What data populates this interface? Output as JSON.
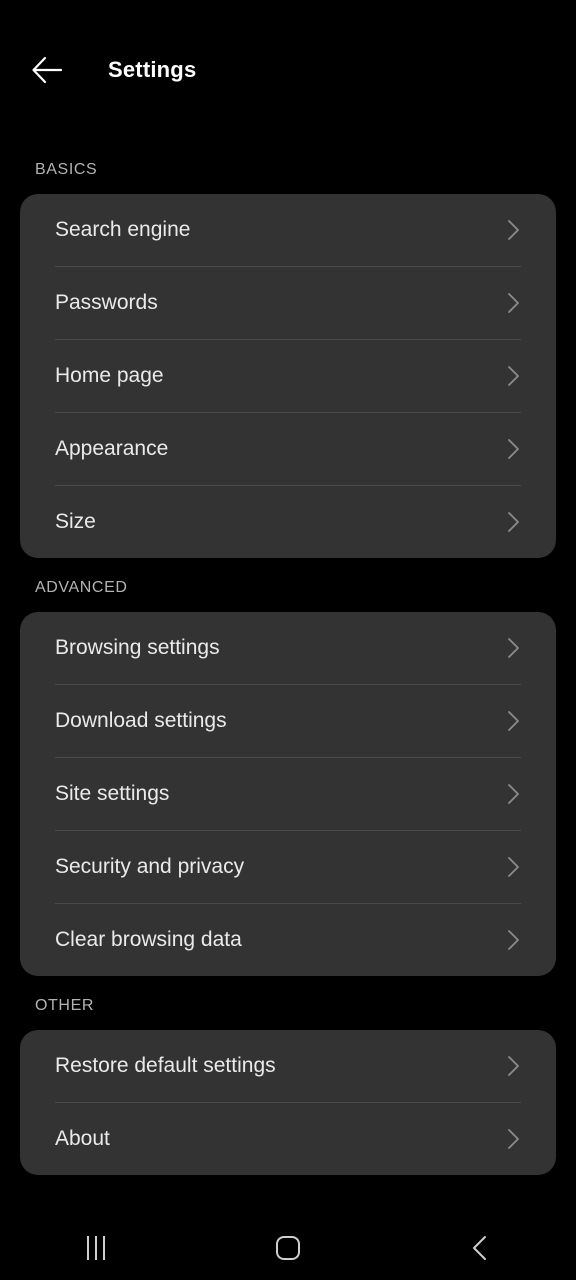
{
  "appbar": {
    "back_icon": "arrow-left-icon",
    "title": "Settings"
  },
  "sections": [
    {
      "header": "BASICS",
      "items": [
        {
          "label": "Search engine",
          "chevron": "chevron-right-icon"
        },
        {
          "label": "Passwords",
          "chevron": "chevron-right-icon"
        },
        {
          "label": "Home page",
          "chevron": "chevron-right-icon"
        },
        {
          "label": "Appearance",
          "chevron": "chevron-right-icon"
        },
        {
          "label": "Size",
          "chevron": "chevron-right-icon"
        }
      ]
    },
    {
      "header": "ADVANCED",
      "items": [
        {
          "label": "Browsing settings",
          "chevron": "chevron-right-icon"
        },
        {
          "label": "Download settings",
          "chevron": "chevron-right-icon"
        },
        {
          "label": "Site settings",
          "chevron": "chevron-right-icon"
        },
        {
          "label": "Security and privacy",
          "chevron": "chevron-right-icon"
        },
        {
          "label": "Clear browsing data",
          "chevron": "chevron-right-icon"
        }
      ]
    },
    {
      "header": "OTHER",
      "items": [
        {
          "label": "Restore default settings",
          "chevron": "chevron-right-icon"
        },
        {
          "label": "About",
          "chevron": "chevron-right-icon"
        }
      ]
    }
  ],
  "navbar": {
    "recents": "recent-apps-icon",
    "home": "home-icon",
    "back": "back-chevron-icon"
  },
  "colors": {
    "page_background": "#000000",
    "card_background": "#333333",
    "divider": "#4a4a4a",
    "primary_text": "#eaeaea",
    "section_header_text": "#b3b3b3",
    "title_text": "#ffffff",
    "chevron": "#8c8c8c",
    "nav_icon": "#cfcfcf"
  }
}
